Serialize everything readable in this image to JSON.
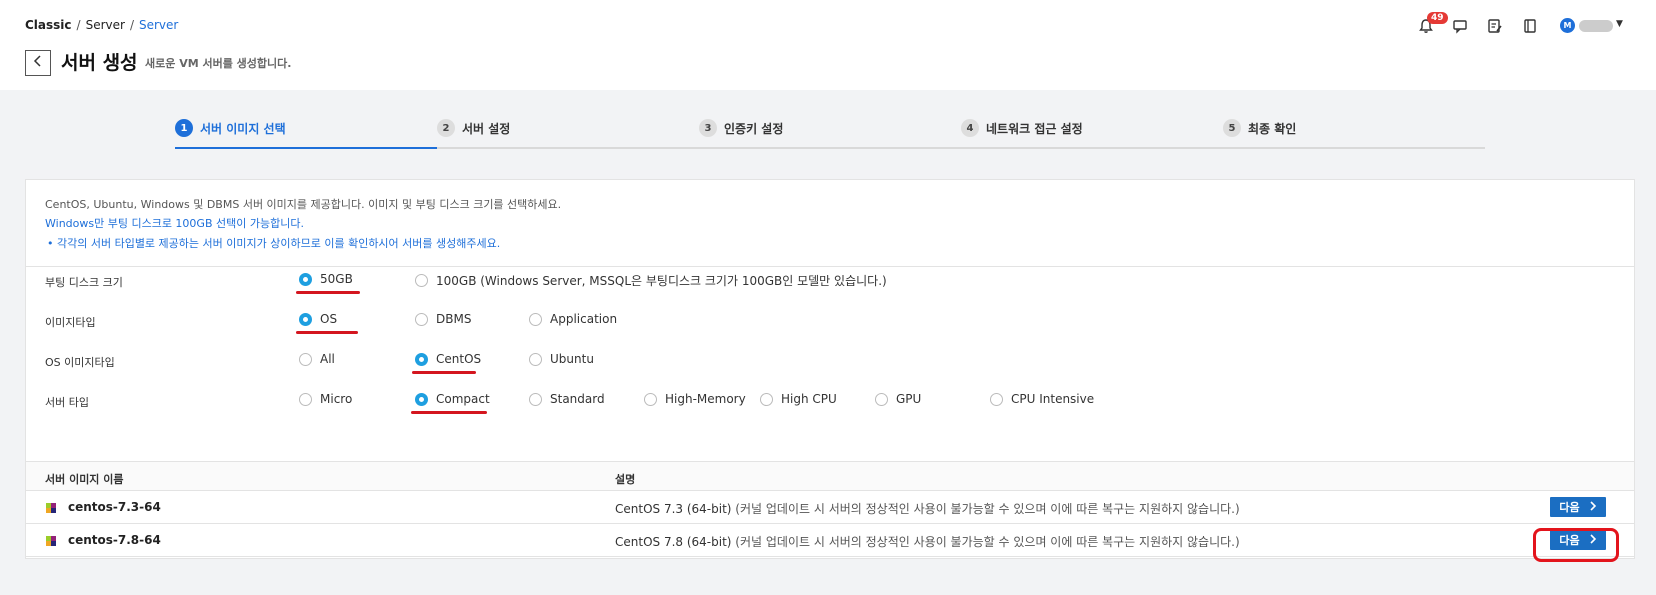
{
  "breadcrumb": {
    "first": "Classic",
    "second": "Server",
    "third": "Server",
    "sep": "/"
  },
  "page": {
    "title": "서버 생성",
    "subtitle": "새로운 VM 서버를 생성합니다."
  },
  "header": {
    "notification_count": "49",
    "avatar_initial": "M"
  },
  "steps": [
    {
      "num": "1",
      "label": "서버 이미지 선택",
      "active": true
    },
    {
      "num": "2",
      "label": "서버 설정"
    },
    {
      "num": "3",
      "label": "인증키 설정"
    },
    {
      "num": "4",
      "label": "네트워크 접근 설정"
    },
    {
      "num": "5",
      "label": "최종 확인"
    }
  ],
  "info": {
    "line1": "CentOS, Ubuntu, Windows 및 DBMS 서버 이미지를 제공합니다. 이미지 및 부팅 디스크 크기를 선택하세요.",
    "line2": "Windows만 부팅 디스크로 100GB 선택이 가능합니다.",
    "line3": "•  각각의 서버 타입별로 제공하는 서버 이미지가 상이하므로 이를 확인하시어 서버를 생성해주세요."
  },
  "options": {
    "boot_disk": {
      "label": "부팅 디스크 크기",
      "choices": [
        "50GB",
        "100GB (Windows Server, MSSQL은 부팅디스크 크기가 100GB인 모델만 있습니다.)"
      ],
      "selected": "50GB"
    },
    "image_type": {
      "label": "이미지타입",
      "choices": [
        "OS",
        "DBMS",
        "Application"
      ],
      "selected": "OS"
    },
    "os_image_type": {
      "label": "OS 이미지타입",
      "choices": [
        "All",
        "CentOS",
        "Ubuntu"
      ],
      "selected": "CentOS"
    },
    "server_type": {
      "label": "서버 타입",
      "choices": [
        "Micro",
        "Compact",
        "Standard",
        "High-Memory",
        "High CPU",
        "GPU",
        "CPU Intensive"
      ],
      "selected": "Compact"
    }
  },
  "table": {
    "col_name": "서버 이미지 이름",
    "col_desc": "설명",
    "rows": [
      {
        "name": "centos-7.3-64",
        "desc": "CentOS 7.3 (64-bit)",
        "note": "(커널 업데이트 시 서버의 정상적인 사용이 불가능할 수 있으며 이에 따른 복구는 지원하지 않습니다.)",
        "button": "다음"
      },
      {
        "name": "centos-7.8-64",
        "desc": "CentOS 7.8 (64-bit)",
        "note": "(커널 업데이트 시 서버의 정상적인 사용이 불가능할 수 있으며 이에 따른 복구는 지원하지 않습니다.)",
        "button": "다음"
      }
    ]
  },
  "colors": {
    "accent": "#1e6fd9",
    "radio_checked": "#1e9fe0",
    "highlight_red": "#d4161f",
    "button": "#1b6ec2"
  },
  "icons": [
    "bell-icon",
    "chat-icon",
    "edit-note-icon",
    "book-icon",
    "back-arrow-icon",
    "chevron-right-icon",
    "centos-logo-icon"
  ]
}
